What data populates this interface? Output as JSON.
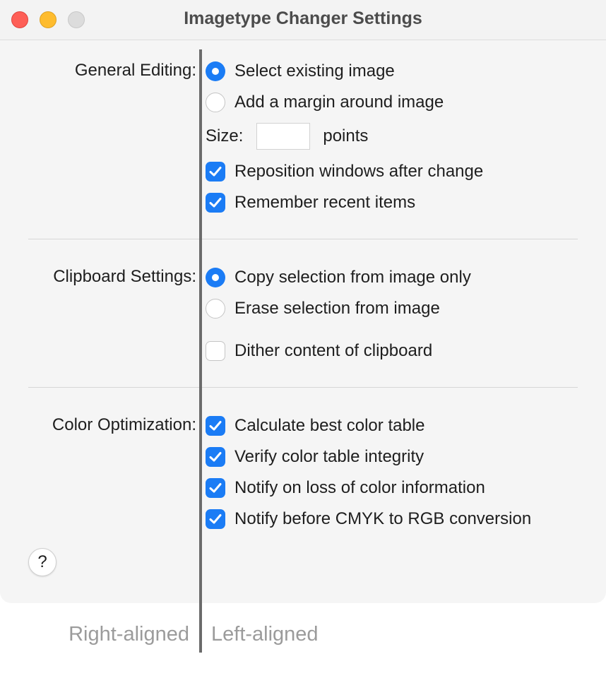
{
  "window": {
    "title": "Imagetype Changer Settings"
  },
  "general": {
    "label": "General Editing:",
    "option_select": "Select existing image",
    "option_margin": "Add a margin around image",
    "size_label": "Size:",
    "size_value": "",
    "size_unit": "points",
    "reposition": "Reposition windows after change",
    "remember": "Remember recent items"
  },
  "clipboard": {
    "label": "Clipboard Settings:",
    "option_copy": "Copy selection from image only",
    "option_erase": "Erase selection from image",
    "dither": "Dither content of clipboard"
  },
  "color": {
    "label": "Color Optimization:",
    "best_table": "Calculate best color table",
    "verify": "Verify color table integrity",
    "notify_loss": "Notify on loss of color information",
    "notify_cmyk": "Notify before CMYK to RGB conversion"
  },
  "help": {
    "label": "?"
  },
  "captions": {
    "right": "Right-aligned",
    "left": "Left-aligned"
  },
  "colors": {
    "accent": "#1b7cf5",
    "close": "#fe5f57",
    "minimize": "#febc2e",
    "zoom_disabled": "#dcdcdc"
  },
  "state": {
    "general_radio_selected": "option_select",
    "reposition_checked": true,
    "remember_checked": true,
    "clipboard_radio_selected": "option_copy",
    "dither_checked": false,
    "best_table_checked": true,
    "verify_checked": true,
    "notify_loss_checked": true,
    "notify_cmyk_checked": true
  }
}
